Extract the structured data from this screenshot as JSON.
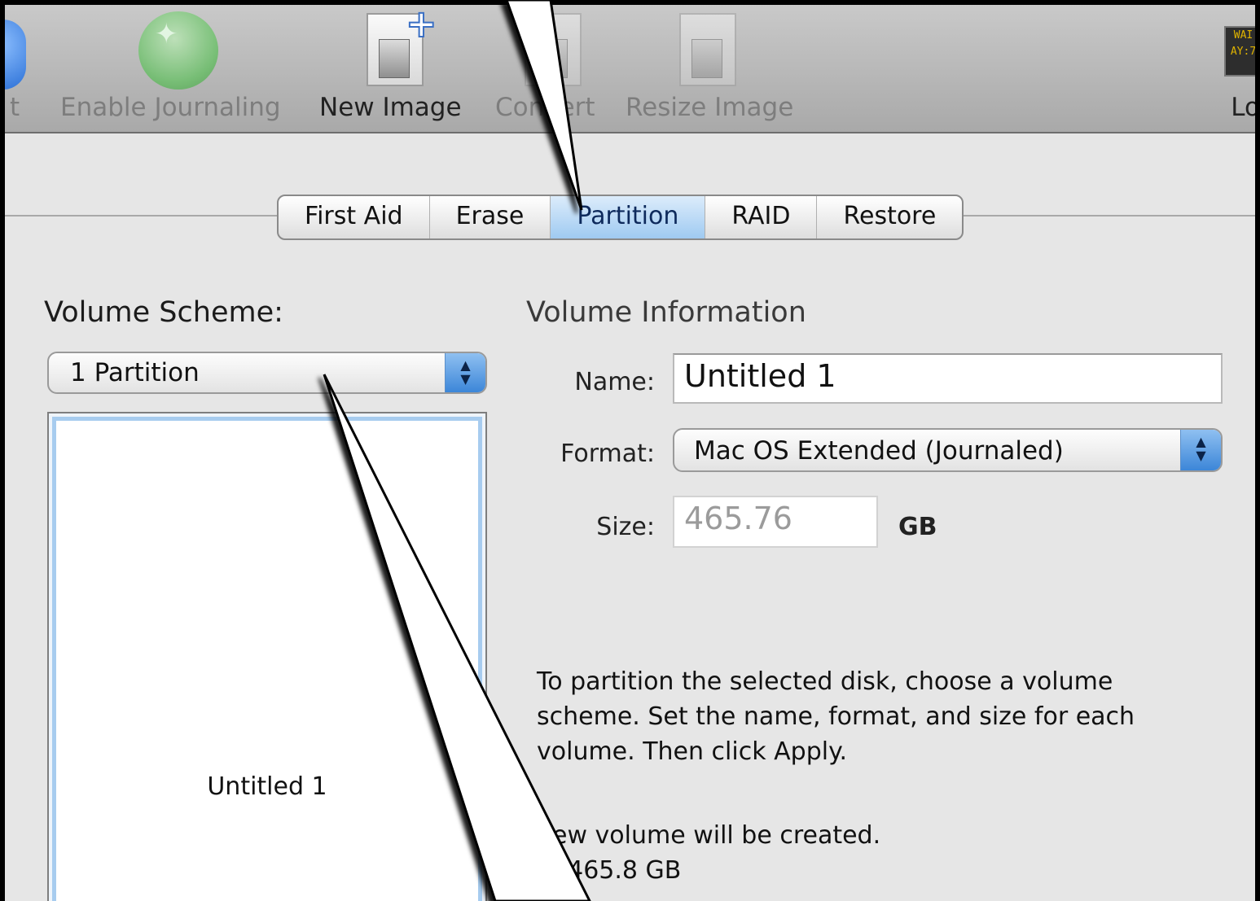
{
  "toolbar": {
    "items": [
      {
        "label": "t"
      },
      {
        "label": "Enable Journaling"
      },
      {
        "label": "New Image"
      },
      {
        "label": "Convert"
      },
      {
        "label": "Resize Image"
      }
    ],
    "right_label": "Lo",
    "right_icon_text": "WAI\nAY:7"
  },
  "tabs": [
    "First Aid",
    "Erase",
    "Partition",
    "RAID",
    "Restore"
  ],
  "selected_tab": "Partition",
  "volume_scheme": {
    "heading": "Volume Scheme:",
    "selected": "1 Partition",
    "map_label": "Untitled 1"
  },
  "volume_info": {
    "heading": "Volume Information",
    "name_label": "Name:",
    "name_value": "Untitled 1",
    "format_label": "Format:",
    "format_value": "Mac OS Extended (Journaled)",
    "size_label": "Size:",
    "size_value": "465.76",
    "size_unit": "GB"
  },
  "description": "To partition the selected disk, choose a volume scheme. Set the name, format, and size for each volume. Then click Apply.",
  "info_line_1": "new volume will be created.",
  "info_line_2": "e: 465.8 GB",
  "colors": {
    "tab_selected": "#9fcaf1",
    "stepper_blue": "#3c86d8",
    "map_border": "#a7ccef"
  }
}
